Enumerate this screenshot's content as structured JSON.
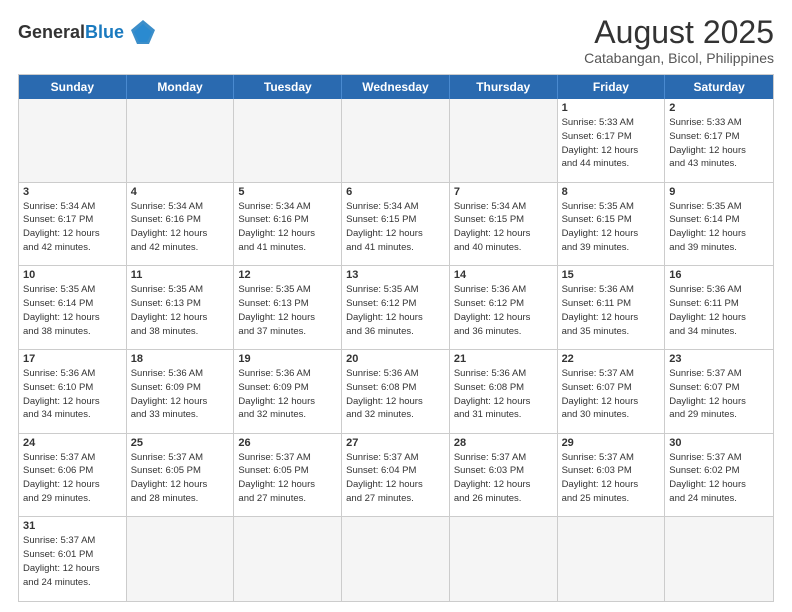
{
  "header": {
    "logo_text_general": "General",
    "logo_text_blue": "Blue",
    "month": "August 2025",
    "location": "Catabangan, Bicol, Philippines"
  },
  "weekdays": [
    "Sunday",
    "Monday",
    "Tuesday",
    "Wednesday",
    "Thursday",
    "Friday",
    "Saturday"
  ],
  "rows": [
    [
      {
        "day": "",
        "empty": true,
        "info": ""
      },
      {
        "day": "",
        "empty": true,
        "info": ""
      },
      {
        "day": "",
        "empty": true,
        "info": ""
      },
      {
        "day": "",
        "empty": true,
        "info": ""
      },
      {
        "day": "",
        "empty": true,
        "info": ""
      },
      {
        "day": "1",
        "empty": false,
        "info": "Sunrise: 5:33 AM\nSunset: 6:17 PM\nDaylight: 12 hours\nand 44 minutes."
      },
      {
        "day": "2",
        "empty": false,
        "info": "Sunrise: 5:33 AM\nSunset: 6:17 PM\nDaylight: 12 hours\nand 43 minutes."
      }
    ],
    [
      {
        "day": "3",
        "empty": false,
        "info": "Sunrise: 5:34 AM\nSunset: 6:17 PM\nDaylight: 12 hours\nand 42 minutes."
      },
      {
        "day": "4",
        "empty": false,
        "info": "Sunrise: 5:34 AM\nSunset: 6:16 PM\nDaylight: 12 hours\nand 42 minutes."
      },
      {
        "day": "5",
        "empty": false,
        "info": "Sunrise: 5:34 AM\nSunset: 6:16 PM\nDaylight: 12 hours\nand 41 minutes."
      },
      {
        "day": "6",
        "empty": false,
        "info": "Sunrise: 5:34 AM\nSunset: 6:15 PM\nDaylight: 12 hours\nand 41 minutes."
      },
      {
        "day": "7",
        "empty": false,
        "info": "Sunrise: 5:34 AM\nSunset: 6:15 PM\nDaylight: 12 hours\nand 40 minutes."
      },
      {
        "day": "8",
        "empty": false,
        "info": "Sunrise: 5:35 AM\nSunset: 6:15 PM\nDaylight: 12 hours\nand 39 minutes."
      },
      {
        "day": "9",
        "empty": false,
        "info": "Sunrise: 5:35 AM\nSunset: 6:14 PM\nDaylight: 12 hours\nand 39 minutes."
      }
    ],
    [
      {
        "day": "10",
        "empty": false,
        "info": "Sunrise: 5:35 AM\nSunset: 6:14 PM\nDaylight: 12 hours\nand 38 minutes."
      },
      {
        "day": "11",
        "empty": false,
        "info": "Sunrise: 5:35 AM\nSunset: 6:13 PM\nDaylight: 12 hours\nand 38 minutes."
      },
      {
        "day": "12",
        "empty": false,
        "info": "Sunrise: 5:35 AM\nSunset: 6:13 PM\nDaylight: 12 hours\nand 37 minutes."
      },
      {
        "day": "13",
        "empty": false,
        "info": "Sunrise: 5:35 AM\nSunset: 6:12 PM\nDaylight: 12 hours\nand 36 minutes."
      },
      {
        "day": "14",
        "empty": false,
        "info": "Sunrise: 5:36 AM\nSunset: 6:12 PM\nDaylight: 12 hours\nand 36 minutes."
      },
      {
        "day": "15",
        "empty": false,
        "info": "Sunrise: 5:36 AM\nSunset: 6:11 PM\nDaylight: 12 hours\nand 35 minutes."
      },
      {
        "day": "16",
        "empty": false,
        "info": "Sunrise: 5:36 AM\nSunset: 6:11 PM\nDaylight: 12 hours\nand 34 minutes."
      }
    ],
    [
      {
        "day": "17",
        "empty": false,
        "info": "Sunrise: 5:36 AM\nSunset: 6:10 PM\nDaylight: 12 hours\nand 34 minutes."
      },
      {
        "day": "18",
        "empty": false,
        "info": "Sunrise: 5:36 AM\nSunset: 6:09 PM\nDaylight: 12 hours\nand 33 minutes."
      },
      {
        "day": "19",
        "empty": false,
        "info": "Sunrise: 5:36 AM\nSunset: 6:09 PM\nDaylight: 12 hours\nand 32 minutes."
      },
      {
        "day": "20",
        "empty": false,
        "info": "Sunrise: 5:36 AM\nSunset: 6:08 PM\nDaylight: 12 hours\nand 32 minutes."
      },
      {
        "day": "21",
        "empty": false,
        "info": "Sunrise: 5:36 AM\nSunset: 6:08 PM\nDaylight: 12 hours\nand 31 minutes."
      },
      {
        "day": "22",
        "empty": false,
        "info": "Sunrise: 5:37 AM\nSunset: 6:07 PM\nDaylight: 12 hours\nand 30 minutes."
      },
      {
        "day": "23",
        "empty": false,
        "info": "Sunrise: 5:37 AM\nSunset: 6:07 PM\nDaylight: 12 hours\nand 29 minutes."
      }
    ],
    [
      {
        "day": "24",
        "empty": false,
        "info": "Sunrise: 5:37 AM\nSunset: 6:06 PM\nDaylight: 12 hours\nand 29 minutes."
      },
      {
        "day": "25",
        "empty": false,
        "info": "Sunrise: 5:37 AM\nSunset: 6:05 PM\nDaylight: 12 hours\nand 28 minutes."
      },
      {
        "day": "26",
        "empty": false,
        "info": "Sunrise: 5:37 AM\nSunset: 6:05 PM\nDaylight: 12 hours\nand 27 minutes."
      },
      {
        "day": "27",
        "empty": false,
        "info": "Sunrise: 5:37 AM\nSunset: 6:04 PM\nDaylight: 12 hours\nand 27 minutes."
      },
      {
        "day": "28",
        "empty": false,
        "info": "Sunrise: 5:37 AM\nSunset: 6:03 PM\nDaylight: 12 hours\nand 26 minutes."
      },
      {
        "day": "29",
        "empty": false,
        "info": "Sunrise: 5:37 AM\nSunset: 6:03 PM\nDaylight: 12 hours\nand 25 minutes."
      },
      {
        "day": "30",
        "empty": false,
        "info": "Sunrise: 5:37 AM\nSunset: 6:02 PM\nDaylight: 12 hours\nand 24 minutes."
      }
    ],
    [
      {
        "day": "31",
        "empty": false,
        "info": "Sunrise: 5:37 AM\nSunset: 6:01 PM\nDaylight: 12 hours\nand 24 minutes."
      },
      {
        "day": "",
        "empty": true,
        "info": ""
      },
      {
        "day": "",
        "empty": true,
        "info": ""
      },
      {
        "day": "",
        "empty": true,
        "info": ""
      },
      {
        "day": "",
        "empty": true,
        "info": ""
      },
      {
        "day": "",
        "empty": true,
        "info": ""
      },
      {
        "day": "",
        "empty": true,
        "info": ""
      }
    ]
  ]
}
